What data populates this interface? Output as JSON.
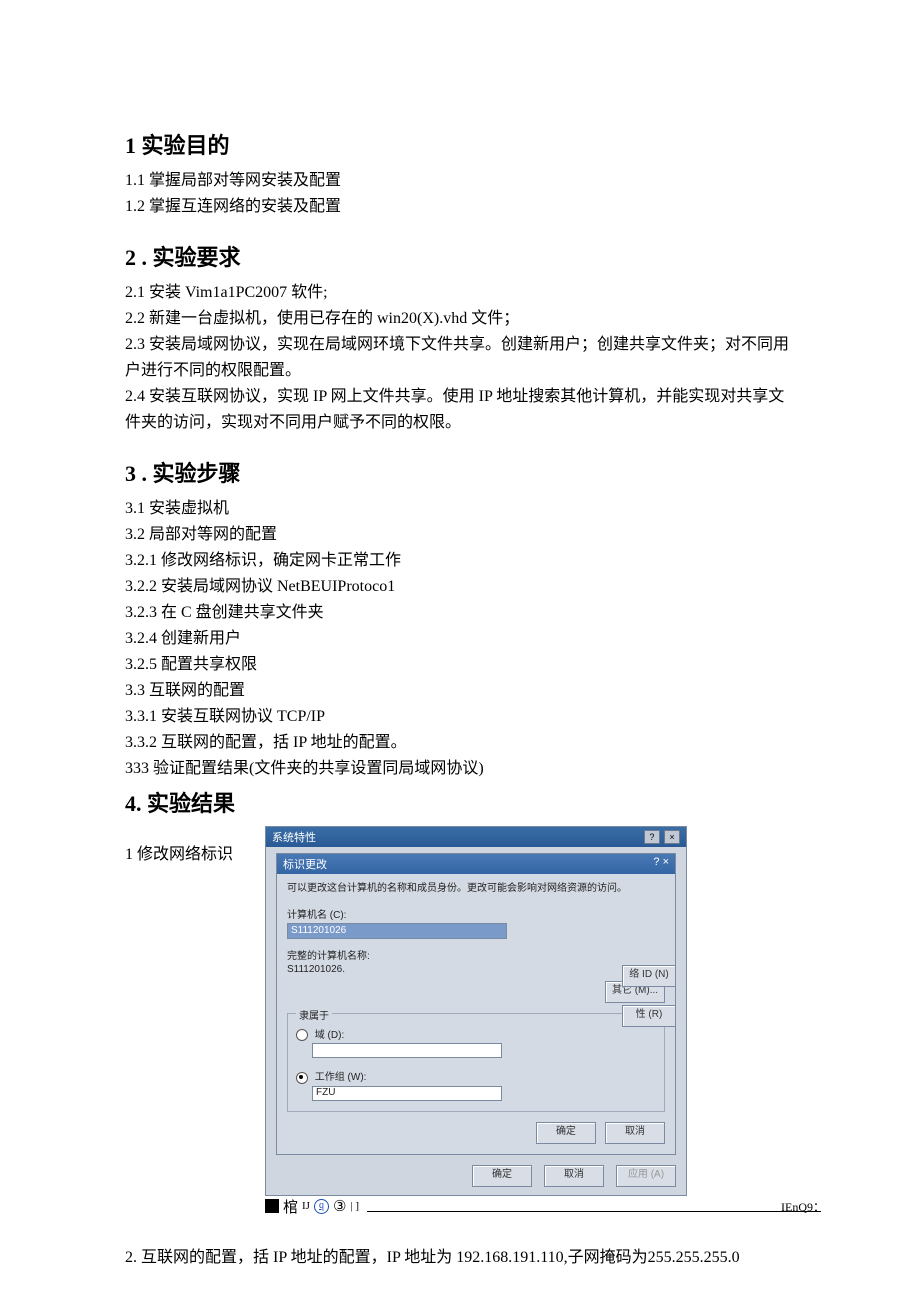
{
  "sections": {
    "s1_title": "1 实验目的",
    "s1_1": "1.1   掌握局部对等网安装及配置",
    "s1_2": "1.2   掌握互连网络的安装及配置",
    "s2_title": "2  . 实验要求",
    "s2_1": "2.1   安装 Vim1a1PC2007 软件;",
    "s2_2": "2.2   新建一台虚拟机，使用已存在的 win20(X).vhd 文件；",
    "s2_3": "2.3   安装局域网协议，实现在局域网环境下文件共享。创建新用户；创建共享文件夹；对不同用户进行不同的权限配置。",
    "s2_4": "2.4   安装互联网协议，实现 IP 网上文件共享。使用 IP 地址搜索其他计算机，并能实现对共享文件夹的访问，实现对不同用户赋予不同的权限。",
    "s3_title": "3  . 实验步骤",
    "s3_1": "3.1   安装虚拟机",
    "s3_2": "3.2   局部对等网的配置",
    "s3_2_1": "3.2.1   修改网络标识，确定网卡正常工作",
    "s3_2_2": "3.2.2   安装局域网协议 NetBEUIProtoco1",
    "s3_2_3": "3.2.3   在 C 盘创建共享文件夹",
    "s3_2_4": "3.2.4   创建新用户",
    "s3_2_5": "3.2.5   配置共享权限",
    "s3_3": "3.3   互联网的配置",
    "s3_3_1": "3.3.1   安装互联网协议 TCP/IP",
    "s3_3_2": "3.3.2   互联网的配置，括 IP 地址的配置。",
    "s3_3_3": "333 验证配置结果(文件夹的共享设置同局域网协议)",
    "s4_title": "4. 实验结果",
    "s4_1_label": "1 修改网络标识",
    "s4_2": " 2. 互联网的配置，括 IP 地址的配置，IP 地址为 192.168.191.110,子网掩码为255.255.255.0"
  },
  "dialog": {
    "outer_title": "系统特性",
    "inner_title": "标识更改",
    "desc": "可以更改这台计算机的名称和成员身份。更改可能会影响对网络资源的访问。",
    "comp_label": "计算机名 (C):",
    "comp_value": "S111201026",
    "full_label": "完整的计算机名称:",
    "full_value": "S111201026.",
    "other_btn": "其它 (M)...",
    "group_legend": "隶属于",
    "radio_domain": "域 (D):",
    "radio_wg": "工作组 (W):",
    "wg_value": "FZU",
    "ok": "确定",
    "cancel": "取消",
    "apply": "应用 (A)",
    "side1": "络 ID (N)",
    "side2": "性 (R)"
  },
  "glyphs": {
    "left": "棺",
    "mid": "IJ",
    "q": "q",
    "three": "③",
    "bar": "| ]",
    "right": "IEnQ9："
  }
}
